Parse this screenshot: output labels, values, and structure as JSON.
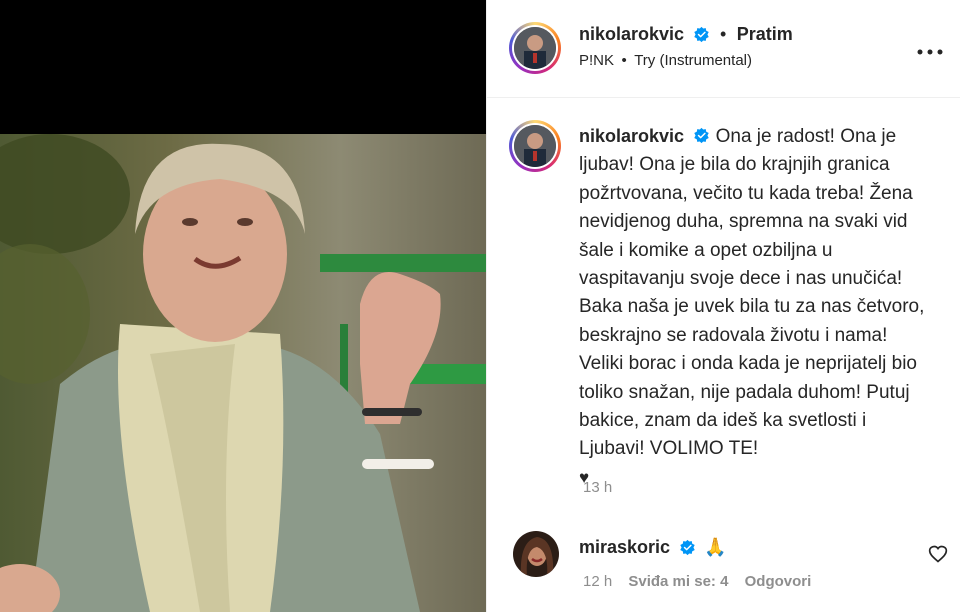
{
  "header": {
    "username": "nikolarokvic",
    "separator": "•",
    "follow_status": "Pratim",
    "song_artist": "P!NK",
    "song_separator": "•",
    "song_title": "Try (Instrumental)"
  },
  "caption": {
    "username": "nikolarokvic",
    "text": "Ona je radost! Ona je ljubav! Ona je bila do krajnjih granica požrtvovana, večito tu kada treba! Žena nevidjenog duha, spremna na svaki vid šale i komike a opet ozbiljna u vaspitavanju svoje dece i nas unučića! Baka naša je uvek bila tu za nas četvoro, beskrajno se radovala životu i nama! Veliki borac i onda kada je neprijatelj bio toliko snažan, nije padala duhom! Putuj bakice, znam da ideš ka svetlosti i Ljubavi! VOLIMO TE!",
    "emoji": "♥",
    "time": "13 h"
  },
  "comment": {
    "username": "miraskoric",
    "text": "🙏",
    "time": "12 h",
    "likes": "Sviđa mi se: 4",
    "reply": "Odgovori"
  },
  "icons": {
    "verified": "verified-badge-icon",
    "more": "more-options-icon",
    "like": "heart-outline-icon"
  },
  "colors": {
    "verified_blue": "#0095f6",
    "text": "#262626",
    "muted": "#8e8e8e"
  }
}
